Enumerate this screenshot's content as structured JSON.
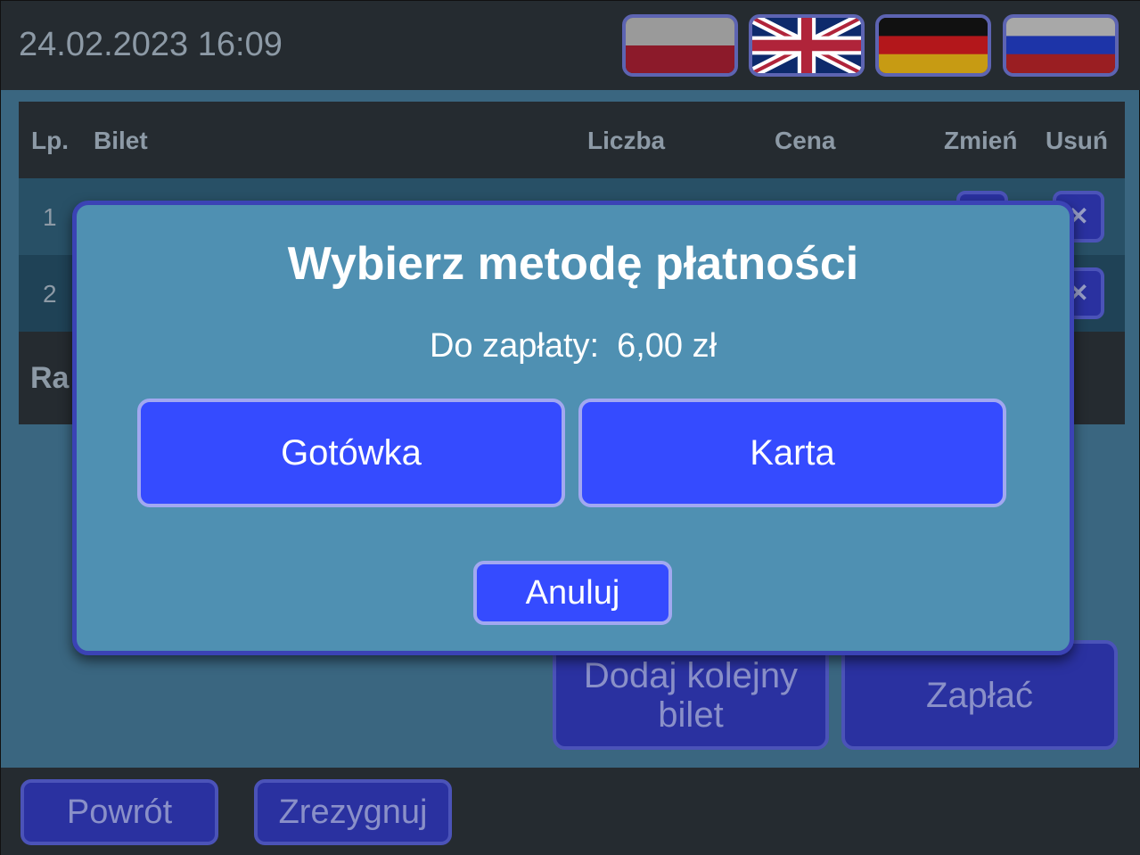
{
  "header": {
    "datetime": "24.02.2023 16:09",
    "languages": [
      {
        "code": "pl",
        "icon": "poland-flag-icon"
      },
      {
        "code": "en",
        "icon": "uk-flag-icon"
      },
      {
        "code": "de",
        "icon": "germany-flag-icon"
      },
      {
        "code": "ru",
        "icon": "russia-flag-icon"
      }
    ]
  },
  "table": {
    "columns": {
      "lp": "Lp.",
      "ticket": "Bilet",
      "count": "Liczba",
      "price": "Cena",
      "change": "Zmień",
      "remove": "Usuń"
    },
    "rows": [
      {
        "lp": "1"
      },
      {
        "lp": "2"
      }
    ],
    "summary_label": "Ra"
  },
  "actions": {
    "add_ticket": "Dodaj kolejny bilet",
    "pay": "Zapłać"
  },
  "footer": {
    "back": "Powrót",
    "resign": "Zrezygnuj"
  },
  "modal": {
    "title": "Wybierz metodę płatności",
    "amount_label": "Do zapłaty:",
    "amount_value": "6,00 zł",
    "cash": "Gotówka",
    "card": "Karta",
    "cancel": "Anuluj"
  },
  "colors": {
    "dark_bar": "#252b30",
    "background": "#3a6680",
    "modal_bg": "#4f90b2",
    "button_blue": "#354bff",
    "button_blue_dimmed": "#2a31a0"
  }
}
